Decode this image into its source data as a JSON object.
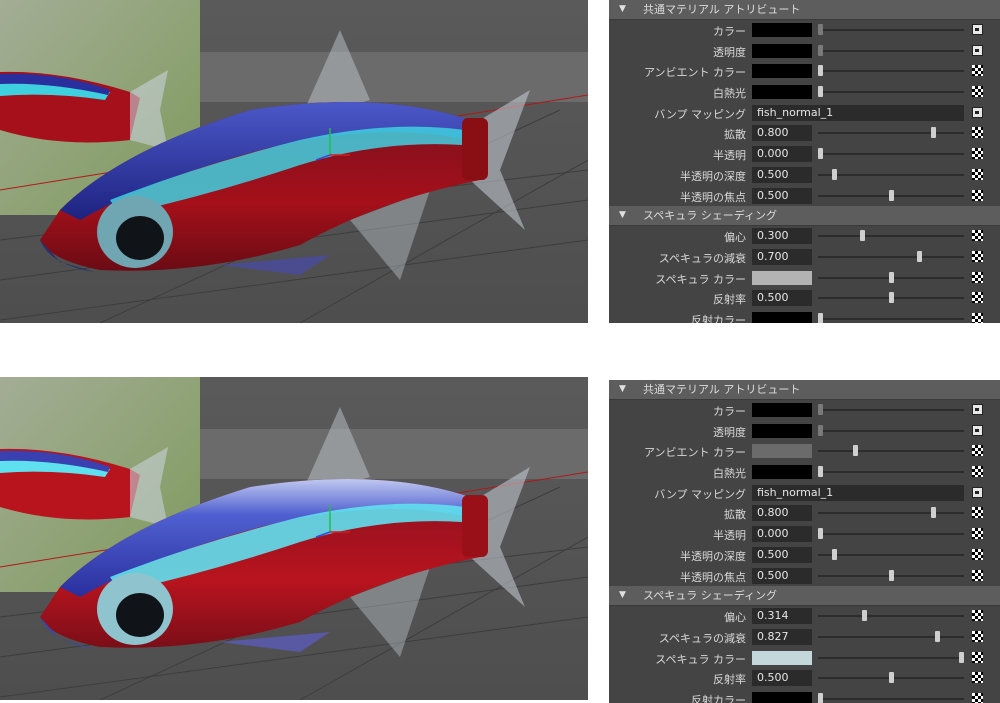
{
  "top": {
    "sections": [
      {
        "title": "共通マテリアル アトリビュート",
        "rows": [
          {
            "label": "カラー",
            "kind": "swatch",
            "swatch": "#000000",
            "slider": 0.0,
            "map": "conn"
          },
          {
            "label": "透明度",
            "kind": "swatch",
            "swatch": "#000000",
            "slider": 0.0,
            "map": "conn"
          },
          {
            "label": "アンビエント カラー",
            "kind": "swatch",
            "swatch": "#000000",
            "slider": 0.0,
            "map": "checker"
          },
          {
            "label": "白熱光",
            "kind": "swatch",
            "swatch": "#000000",
            "slider": 0.0,
            "map": "checker"
          },
          {
            "label": "バンプ マッピング",
            "kind": "text",
            "value": "fish_normal_1",
            "map": "conn"
          },
          {
            "label": "拡散",
            "kind": "num",
            "value": "0.800",
            "slider": 0.8,
            "map": "checker"
          },
          {
            "label": "半透明",
            "kind": "num",
            "value": "0.000",
            "slider": 0.0,
            "map": "checker"
          },
          {
            "label": "半透明の深度",
            "kind": "num",
            "value": "0.500",
            "slider": 0.1,
            "map": "checker"
          },
          {
            "label": "半透明の焦点",
            "kind": "num",
            "value": "0.500",
            "slider": 0.5,
            "map": "checker"
          }
        ]
      },
      {
        "title": "スペキュラ シェーディング",
        "rows": [
          {
            "label": "偏心",
            "kind": "num",
            "value": "0.300",
            "slider": 0.3,
            "map": "checker"
          },
          {
            "label": "スペキュラの減衰",
            "kind": "num",
            "value": "0.700",
            "slider": 0.7,
            "map": "checker"
          },
          {
            "label": "スペキュラ カラー",
            "kind": "swatch",
            "swatch": "#b3b3b3",
            "slider": 0.5,
            "map": "checker"
          },
          {
            "label": "反射率",
            "kind": "num",
            "value": "0.500",
            "slider": 0.5,
            "map": "checker"
          },
          {
            "label": "反射カラー",
            "kind": "swatch",
            "swatch": "#000000",
            "slider": 0.0,
            "map": "checker"
          }
        ]
      }
    ]
  },
  "bottom": {
    "sections": [
      {
        "title": "共通マテリアル アトリビュート",
        "rows": [
          {
            "label": "カラー",
            "kind": "swatch",
            "swatch": "#000000",
            "slider": 0.0,
            "map": "conn"
          },
          {
            "label": "透明度",
            "kind": "swatch",
            "swatch": "#000000",
            "slider": 0.0,
            "map": "conn"
          },
          {
            "label": "アンビエント カラー",
            "kind": "swatch",
            "swatch": "#6b6b6b",
            "slider": 0.25,
            "map": "checker"
          },
          {
            "label": "白熱光",
            "kind": "swatch",
            "swatch": "#000000",
            "slider": 0.0,
            "map": "checker"
          },
          {
            "label": "バンプ マッピング",
            "kind": "text",
            "value": "fish_normal_1",
            "map": "conn"
          },
          {
            "label": "拡散",
            "kind": "num",
            "value": "0.800",
            "slider": 0.8,
            "map": "checker"
          },
          {
            "label": "半透明",
            "kind": "num",
            "value": "0.000",
            "slider": 0.0,
            "map": "checker"
          },
          {
            "label": "半透明の深度",
            "kind": "num",
            "value": "0.500",
            "slider": 0.1,
            "map": "checker"
          },
          {
            "label": "半透明の焦点",
            "kind": "num",
            "value": "0.500",
            "slider": 0.5,
            "map": "checker"
          }
        ]
      },
      {
        "title": "スペキュラ シェーディング",
        "rows": [
          {
            "label": "偏心",
            "kind": "num",
            "value": "0.314",
            "slider": 0.314,
            "map": "checker"
          },
          {
            "label": "スペキュラの減衰",
            "kind": "num",
            "value": "0.827",
            "slider": 0.827,
            "map": "checker"
          },
          {
            "label": "スペキュラ カラー",
            "kind": "swatch",
            "swatch": "#c4d8dc",
            "slider": 1.0,
            "map": "checker"
          },
          {
            "label": "反射率",
            "kind": "num",
            "value": "0.500",
            "slider": 0.5,
            "map": "checker"
          },
          {
            "label": "反射カラー",
            "kind": "swatch",
            "swatch": "#000000",
            "slider": 0.0,
            "map": "checker"
          }
        ]
      }
    ]
  },
  "colors": {
    "fish_blue": "#2a2f9e",
    "fish_stripe": "#3fd0e0",
    "fish_red": "#a5101a",
    "fin": "#c8d0d8",
    "wall": "#6c6c6c",
    "ground": "#5a5a5a",
    "backplate": "#9aa68c"
  },
  "icons": {
    "expand": "triangle-down-icon",
    "map_connected": "connection-icon",
    "map_unconnected": "checkerboard-icon"
  }
}
